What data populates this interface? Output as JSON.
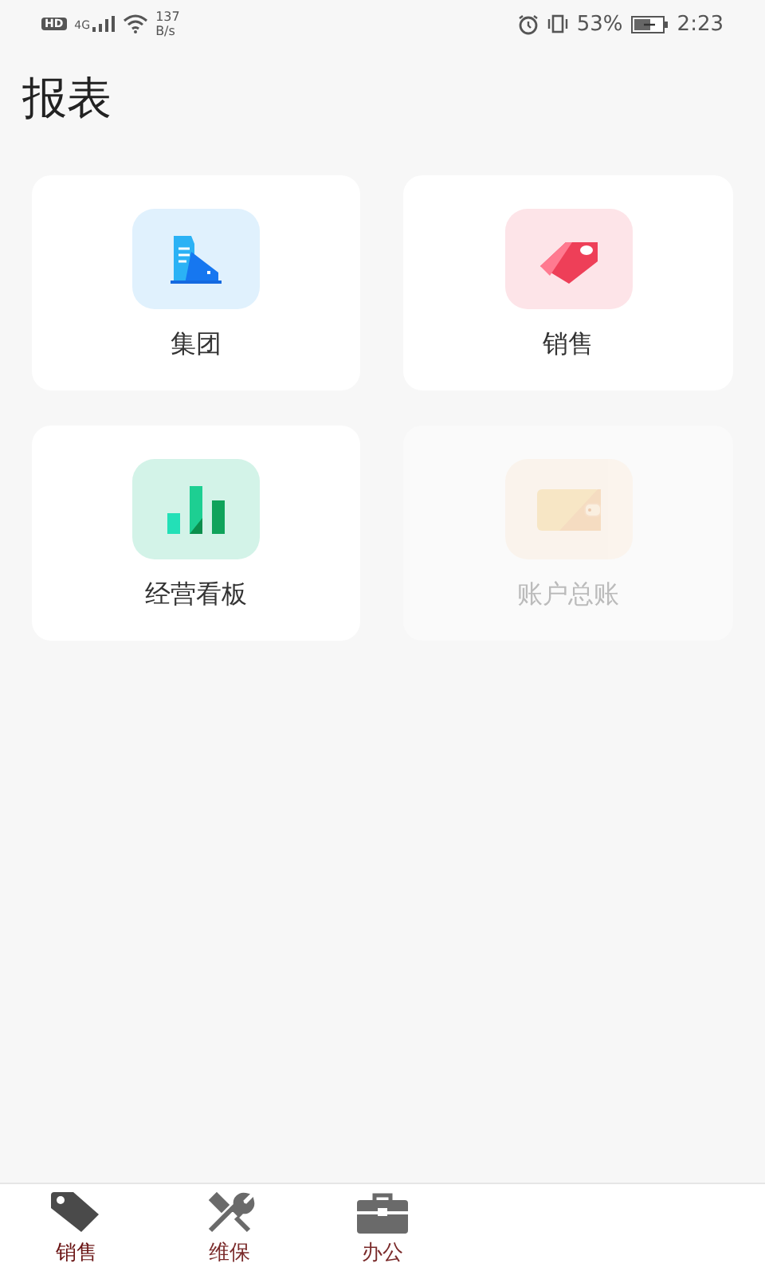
{
  "status_bar": {
    "hd": "HD",
    "network": "4G",
    "speed_value": "137",
    "speed_unit": "B/s",
    "battery": "53%",
    "time": "2:23"
  },
  "title": "报表",
  "cards": [
    {
      "label": "集团",
      "kind": "building",
      "color": "#e0f1fd",
      "disabled": false
    },
    {
      "label": "销售",
      "kind": "tag",
      "color": "#fde4e8",
      "disabled": false
    },
    {
      "label": "经营看板",
      "kind": "chart",
      "color": "#d3f3e8",
      "disabled": false
    },
    {
      "label": "账户总账",
      "kind": "wallet",
      "color": "#fbefe2",
      "disabled": true
    }
  ],
  "tab_bar": [
    {
      "label": "销售",
      "kind": "tag",
      "selected": true
    },
    {
      "label": "维保",
      "kind": "tools",
      "selected": false
    },
    {
      "label": "办公",
      "kind": "briefcase",
      "selected": false
    }
  ]
}
